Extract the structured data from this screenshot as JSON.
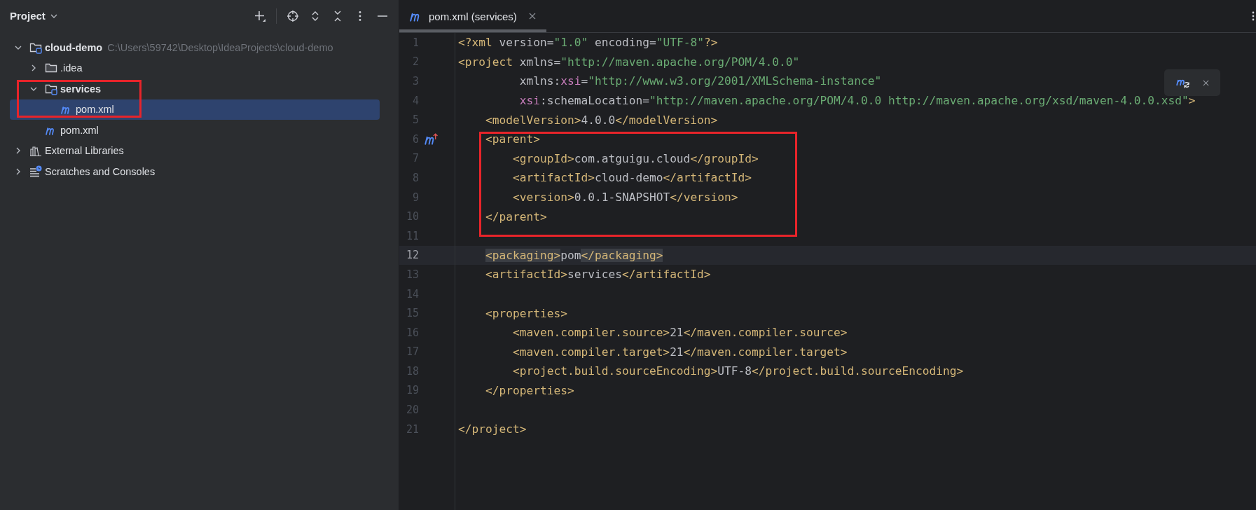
{
  "project_panel": {
    "title": "Project",
    "tree": [
      {
        "label": "cloud-demo",
        "hint": "C:\\Users\\59742\\Desktop\\IdeaProjects\\cloud-demo",
        "kind": "module",
        "bold": true,
        "expanded": true,
        "selected": false,
        "boxed": false,
        "children": [
          {
            "label": ".idea",
            "kind": "folder",
            "bold": false,
            "expanded": false,
            "selected": false,
            "boxed": false
          },
          {
            "label": "services",
            "kind": "module",
            "bold": true,
            "expanded": true,
            "selected": false,
            "boxed": true,
            "children": [
              {
                "label": "pom.xml",
                "kind": "pom",
                "bold": false,
                "selected": true,
                "boxed": false
              }
            ]
          },
          {
            "label": "pom.xml",
            "kind": "pom",
            "bold": false,
            "selected": false,
            "boxed": false
          }
        ]
      },
      {
        "label": "External Libraries",
        "kind": "library",
        "bold": false,
        "expanded": false,
        "selected": false,
        "boxed": false
      },
      {
        "label": "Scratches and Consoles",
        "kind": "scratch",
        "bold": false,
        "expanded": false,
        "selected": false,
        "boxed": false
      }
    ]
  },
  "editor": {
    "tabs": [
      {
        "label": "pom.xml (services)",
        "selected": true
      }
    ],
    "lines": [
      {
        "number": "1",
        "kind": "plain",
        "current": false,
        "boxed": false,
        "tokens": [
          {
            "kind": "tag",
            "text": "<?xml"
          },
          {
            "kind": "text",
            "text": " version="
          },
          {
            "kind": "value",
            "text": "\"1.0\""
          },
          {
            "kind": "text",
            "text": " encoding="
          },
          {
            "kind": "value",
            "text": "\"UTF-8\""
          },
          {
            "kind": "tag",
            "text": "?>"
          }
        ]
      },
      {
        "number": "2",
        "kind": "plain",
        "current": false,
        "boxed": false,
        "tokens": [
          {
            "kind": "tag",
            "text": "<project"
          },
          {
            "kind": "text",
            "text": " xmlns="
          },
          {
            "kind": "value",
            "text": "\"http://maven.apache.org/POM/4.0.0\""
          }
        ]
      },
      {
        "number": "3",
        "kind": "plain",
        "current": false,
        "boxed": false,
        "tokens": [
          {
            "kind": "text",
            "text": "         xmlns:"
          },
          {
            "kind": "ns",
            "text": "xsi"
          },
          {
            "kind": "text",
            "text": "="
          },
          {
            "kind": "value",
            "text": "\"http://www.w3.org/2001/XMLSchema-instance\""
          }
        ]
      },
      {
        "number": "4",
        "kind": "plain",
        "current": false,
        "boxed": false,
        "tokens": [
          {
            "kind": "ns",
            "text": "         xsi"
          },
          {
            "kind": "text",
            "text": ":schemaLocation="
          },
          {
            "kind": "value",
            "text": "\"http://maven.apache.org/POM/4.0.0 http://maven.apache.org/xsd/maven-4.0.0.xsd\""
          },
          {
            "kind": "tag",
            "text": ">"
          }
        ]
      },
      {
        "number": "5",
        "kind": "plain",
        "current": false,
        "boxed": false,
        "tokens": [
          {
            "kind": "tag",
            "text": "    <modelVersion>"
          },
          {
            "kind": "text",
            "text": "4.0.0"
          },
          {
            "kind": "tag",
            "text": "</modelVersion>"
          }
        ]
      },
      {
        "number": "6",
        "kind": "parent",
        "current": false,
        "boxed": true,
        "tokens": [
          {
            "kind": "tag",
            "text": "    <parent>"
          }
        ]
      },
      {
        "number": "7",
        "kind": "plain",
        "current": false,
        "boxed": true,
        "tokens": [
          {
            "kind": "tag",
            "text": "        <groupId>"
          },
          {
            "kind": "text",
            "text": "com.atguigu.cloud"
          },
          {
            "kind": "tag",
            "text": "</groupId>"
          }
        ]
      },
      {
        "number": "8",
        "kind": "plain",
        "current": false,
        "boxed": true,
        "tokens": [
          {
            "kind": "tag",
            "text": "        <artifactId>"
          },
          {
            "kind": "text",
            "text": "cloud-demo"
          },
          {
            "kind": "tag",
            "text": "</artifactId>"
          }
        ]
      },
      {
        "number": "9",
        "kind": "plain",
        "current": false,
        "boxed": true,
        "tokens": [
          {
            "kind": "tag",
            "text": "        <version>"
          },
          {
            "kind": "text",
            "text": "0.0.1-SNAPSHOT"
          },
          {
            "kind": "tag",
            "text": "</version>"
          }
        ]
      },
      {
        "number": "10",
        "kind": "plain",
        "current": false,
        "boxed": true,
        "tokens": [
          {
            "kind": "tag",
            "text": "    </parent>"
          }
        ]
      },
      {
        "number": "11",
        "kind": "plain",
        "current": false,
        "boxed": true
      },
      {
        "number": "12",
        "kind": "plain",
        "current": true,
        "boxed": false,
        "tokens": [
          {
            "kind": "tag",
            "text": "    <packaging>",
            "matched": true
          },
          {
            "kind": "text",
            "text": "pom"
          },
          {
            "kind": "tag",
            "text": "</packaging>",
            "matched": true
          }
        ]
      },
      {
        "number": "13",
        "kind": "plain",
        "current": false,
        "boxed": false,
        "tokens": [
          {
            "kind": "tag",
            "text": "    <artifactId>"
          },
          {
            "kind": "text",
            "text": "services"
          },
          {
            "kind": "tag",
            "text": "</artifactId>"
          }
        ]
      },
      {
        "number": "14",
        "kind": "plain",
        "current": false,
        "boxed": false
      },
      {
        "number": "15",
        "kind": "plain",
        "current": false,
        "boxed": false,
        "tokens": [
          {
            "kind": "tag",
            "text": "    <properties>"
          }
        ]
      },
      {
        "number": "16",
        "kind": "plain",
        "current": false,
        "boxed": false,
        "tokens": [
          {
            "kind": "tag",
            "text": "        <maven.compiler.source>"
          },
          {
            "kind": "text",
            "text": "21"
          },
          {
            "kind": "tag",
            "text": "</maven.compiler.source>"
          }
        ]
      },
      {
        "number": "17",
        "kind": "plain",
        "current": false,
        "boxed": false,
        "tokens": [
          {
            "kind": "tag",
            "text": "        <maven.compiler.target>"
          },
          {
            "kind": "text",
            "text": "21"
          },
          {
            "kind": "tag",
            "text": "</maven.compiler.target>"
          }
        ]
      },
      {
        "number": "18",
        "kind": "plain",
        "current": false,
        "boxed": false,
        "tokens": [
          {
            "kind": "tag",
            "text": "        <project.build.sourceEncoding>"
          },
          {
            "kind": "text",
            "text": "UTF-8"
          },
          {
            "kind": "tag",
            "text": "</project.build.sourceEncoding>"
          }
        ]
      },
      {
        "number": "19",
        "kind": "plain",
        "current": false,
        "boxed": false,
        "tokens": [
          {
            "kind": "tag",
            "text": "    </properties>"
          }
        ]
      },
      {
        "number": "20",
        "kind": "plain",
        "current": false,
        "boxed": false
      },
      {
        "number": "21",
        "kind": "plain",
        "current": false,
        "boxed": false,
        "tokens": [
          {
            "kind": "tag",
            "text": "</project>"
          }
        ]
      }
    ]
  }
}
